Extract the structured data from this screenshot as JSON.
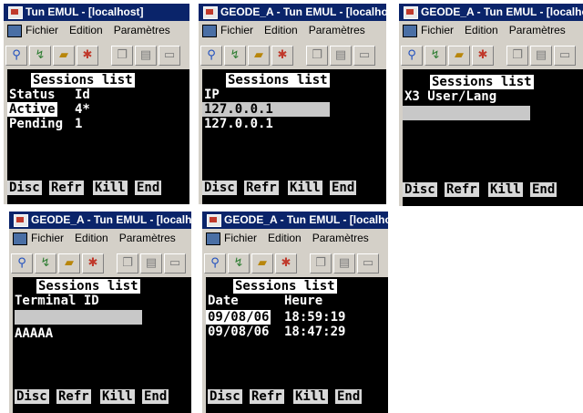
{
  "menu": {
    "file": "Fichier",
    "edit": "Edition",
    "params": "Paramètres"
  },
  "fkeys": {
    "disc": "Disc",
    "refr": "Refr",
    "kill": "Kill",
    "end": "End"
  },
  "windows": [
    {
      "title": "Tun EMUL - [localhost]",
      "screen_title": "Sessions list",
      "col1": "Status",
      "col2": "Id",
      "rows": [
        {
          "status": "Active",
          "id": "4*"
        },
        {
          "status": "Pending",
          "id": "1"
        }
      ]
    },
    {
      "title": "GEODE_A - Tun EMUL - [localhost]",
      "screen_title": "Sessions list",
      "header": "IP",
      "rows": [
        "127.0.0.1",
        "127.0.0.1"
      ]
    },
    {
      "title": "GEODE_A - Tun EMUL - [localhost]",
      "screen_title": "Sessions list",
      "header": "X3 User/Lang"
    },
    {
      "title": "GEODE_A - Tun EMUL - [localhost]",
      "screen_title": "Sessions list",
      "header": "Terminal ID",
      "rows": [
        "AAAAA"
      ]
    },
    {
      "title": "GEODE_A - Tun EMUL - [localhost]",
      "screen_title": "Sessions list",
      "col1": "Date",
      "col2": "Heure",
      "rows": [
        {
          "date": "09/08/06",
          "time": "18:59:19"
        },
        {
          "date": "09/08/06",
          "time": "18:47:29"
        }
      ]
    }
  ]
}
